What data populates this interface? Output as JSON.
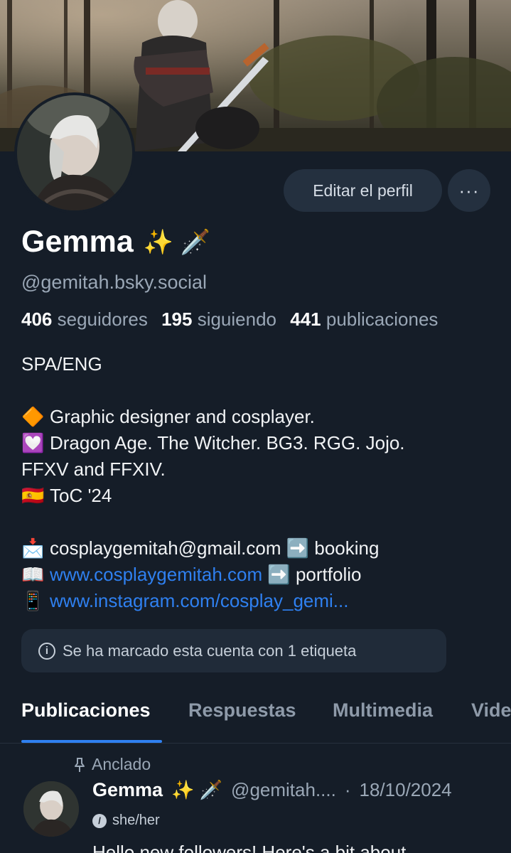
{
  "profile": {
    "display_name": "Gemma",
    "name_emojis": "✨ 🗡️",
    "handle": "@gemitah.bsky.social",
    "edit_button": "Editar el perfil",
    "more_button": "···"
  },
  "stats": {
    "followers_count": "406",
    "followers_label": "seguidores",
    "following_count": "195",
    "following_label": "siguiendo",
    "posts_count": "441",
    "posts_label": "publicaciones"
  },
  "bio": {
    "lang": "SPA/ENG",
    "line1_icon": "🔶",
    "line1": "Graphic designer and cosplayer.",
    "line2_icon": "💟",
    "line2a": "Dragon Age. The Witcher. BG3. RGG. Jojo.",
    "line2b": "FFXV and FFXIV.",
    "line3_icon": "🇪🇸",
    "line3": "ToC '24",
    "email_icon": "📩",
    "email": "cosplaygemitah@gmail.com",
    "arrow_icon": "➡️",
    "email_suffix": "booking",
    "web_icon": "📖",
    "website": "www.cosplaygemitah.com",
    "website_suffix": "portfolio",
    "phone_icon": "📱",
    "instagram": "www.instagram.com/cosplay_gemi..."
  },
  "labels_notice": "Se ha marcado esta cuenta con 1 etiqueta",
  "tabs": [
    {
      "label": "Publicaciones"
    },
    {
      "label": "Respuestas"
    },
    {
      "label": "Multimedia"
    },
    {
      "label": "Vide"
    }
  ],
  "post": {
    "pinned_label": "Anclado",
    "author": "Gemma",
    "author_emojis": "✨ 🗡️",
    "author_handle": "@gemitah....",
    "separator": "·",
    "date": "18/10/2024",
    "pronouns": "she/her",
    "text_preview": "Hello new followers! Here's a bit about"
  },
  "colors": {
    "background": "#151d28",
    "accent": "#2f80f0",
    "button_bg": "#24303f"
  }
}
